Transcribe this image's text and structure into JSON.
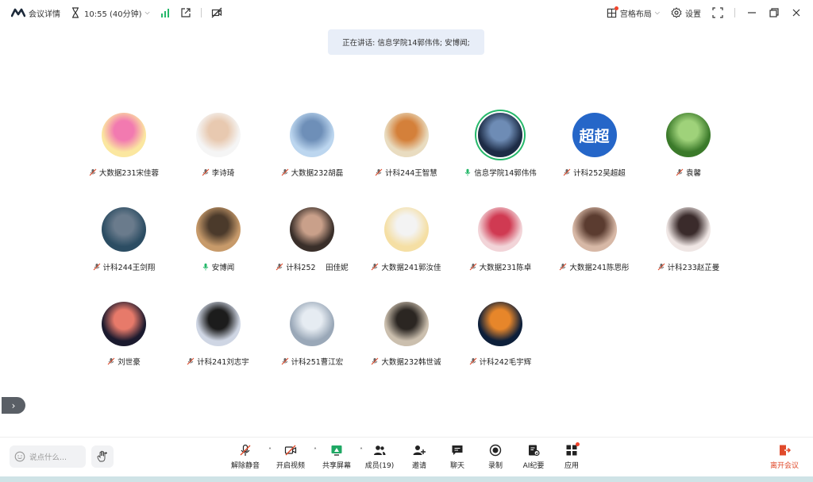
{
  "topbar": {
    "meeting_info": "会议详情",
    "timer": "10:55 (40分钟)",
    "layout_label": "宫格布局",
    "settings_label": "设置"
  },
  "speaking_banner": "正在讲话: 信息学院14郭伟伟; 安博闻;",
  "participants": [
    {
      "name": "大数据231宋佳蓉",
      "muted": true
    },
    {
      "name": "李诗琦",
      "muted": true
    },
    {
      "name": "大数据232胡磊",
      "muted": true
    },
    {
      "name": "计科244王智慧",
      "muted": true
    },
    {
      "name": "信息学院14郭伟伟",
      "muted": false
    },
    {
      "name": "计科252吴超超",
      "muted": true,
      "avatar_text": "超超"
    },
    {
      "name": "袁馨",
      "muted": true
    },
    {
      "name": "计科244王剑翔",
      "muted": true
    },
    {
      "name": "安博闻",
      "muted": false
    },
    {
      "name": "计科252　  田佳妮",
      "muted": true
    },
    {
      "name": "大数据241郭汝佳",
      "muted": true
    },
    {
      "name": "大数据231陈卓",
      "muted": true
    },
    {
      "name": "大数据241陈思彤",
      "muted": true
    },
    {
      "name": "计科233赵芷曼",
      "muted": true
    },
    {
      "name": "刘世豪",
      "muted": true
    },
    {
      "name": "计科241刘志宇",
      "muted": true
    },
    {
      "name": "计科251曹江宏",
      "muted": true
    },
    {
      "name": "大数据232韩世诚",
      "muted": true
    },
    {
      "name": "计科242毛宇辉",
      "muted": true
    }
  ],
  "chat": {
    "placeholder": "说点什么..."
  },
  "toolbar": {
    "unmute": "解除静音",
    "video": "开启视频",
    "share": "共享屏幕",
    "members": "成员(19)",
    "invite": "邀请",
    "chat": "聊天",
    "record": "录制",
    "ai_notes": "AI纪要",
    "apps": "应用",
    "leave": "离开会议"
  },
  "colors": {
    "accent": "#2566c8",
    "speaking": "#25b86a",
    "leave": "#e04a2b",
    "signal": "#25b86a"
  }
}
